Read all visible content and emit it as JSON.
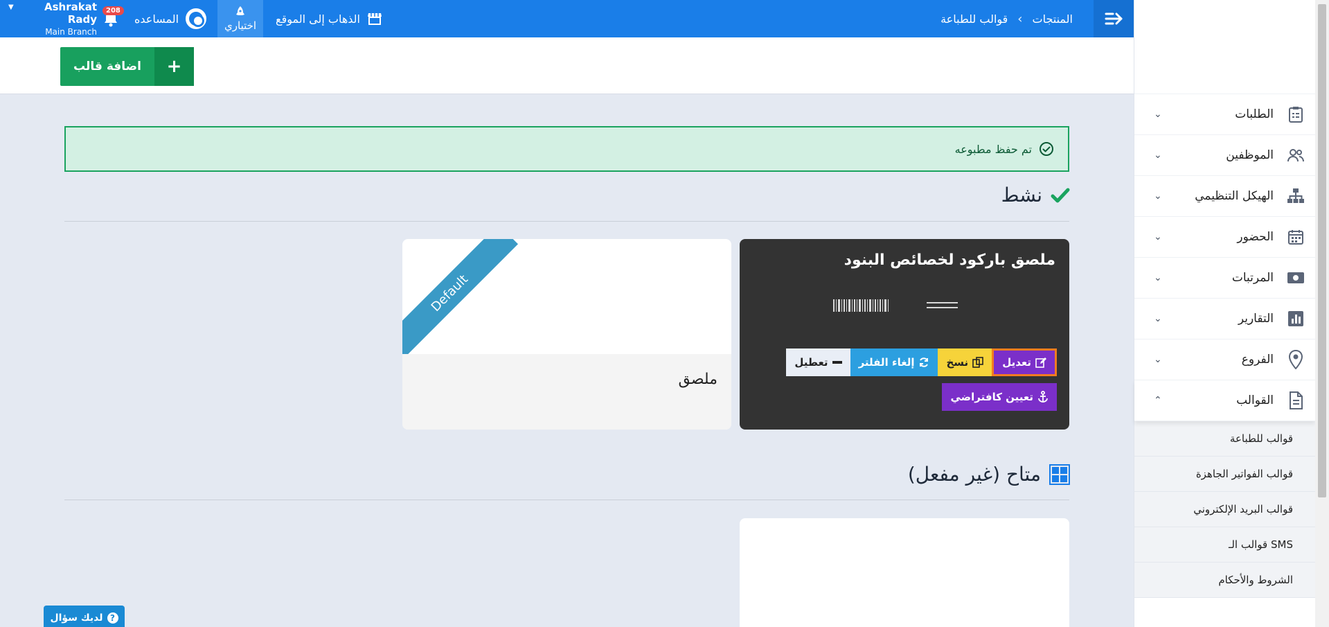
{
  "topbar": {
    "breadcrumb": [
      "المنتجات",
      "قوالب للطباعة"
    ],
    "breadcrumb_sep": "›",
    "goto_site": "الذهاب إلى الموقع",
    "shortcut": "اختياري",
    "help": "المساعده",
    "notifications": "208",
    "user_name": "Ashrakat Rady",
    "user_branch": "Main Branch"
  },
  "actionbar": {
    "add_label": "اضافة قالب",
    "add_icon": "+"
  },
  "alert": {
    "text": "تم حفظ مطبوعه"
  },
  "sections": {
    "active": "نشط",
    "available": "متاح (غير مفعل)"
  },
  "cards": {
    "barcode_title": "ملصق باركود لخصائص البنود",
    "sticker_title": "ملصق",
    "ribbon": "Default",
    "edit": "تعديل",
    "copy": "نسخ",
    "unfilter": "إلغاء الفلتر",
    "disable": "تعطيل",
    "set_default": "تعيين كافتراضي"
  },
  "sidebar": {
    "items": [
      {
        "label": "الطلبات",
        "icon": "clipboard-icon"
      },
      {
        "label": "الموظفين",
        "icon": "users-icon"
      },
      {
        "label": "الهيكل التنظيمي",
        "icon": "org-chart-icon"
      },
      {
        "label": "الحضور",
        "icon": "calendar-icon"
      },
      {
        "label": "المرتبات",
        "icon": "money-icon"
      },
      {
        "label": "التقارير",
        "icon": "bar-chart-icon"
      },
      {
        "label": "الفروع",
        "icon": "map-pin-icon"
      },
      {
        "label": "القوالب",
        "icon": "document-icon"
      }
    ],
    "sub_items": [
      "قوالب للطباعة",
      "قوالب الفواتير الجاهزة",
      "قوالب البريد الإلكتروني",
      "قوالب الـ SMS",
      "الشروط والأحكام"
    ]
  },
  "question": {
    "label": "لديك سؤال",
    "icon": "?"
  },
  "colors": {
    "primary": "#1a7ee8",
    "success": "#18a05e",
    "purple": "#7b2fc9",
    "accent_orange": "#f27c21"
  }
}
